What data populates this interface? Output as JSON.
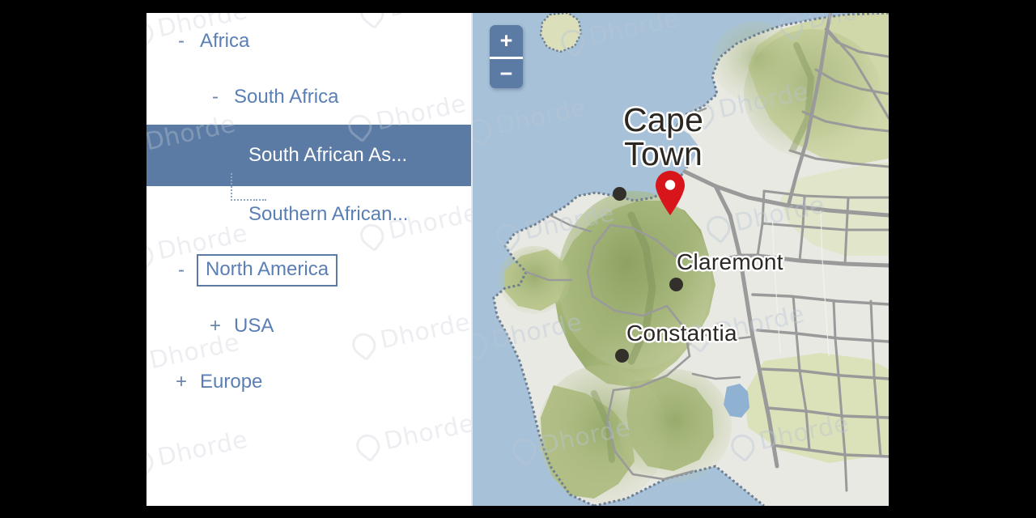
{
  "app": {
    "watermark_text": "Dhorde",
    "watermark_icon": "droplet-leaf-logo"
  },
  "sidebar": {
    "name": "region-tree",
    "items": [
      {
        "label": "Africa",
        "toggle": "-",
        "depth": 0,
        "state": "expanded"
      },
      {
        "label": "South Africa",
        "toggle": "-",
        "depth": 1,
        "state": "expanded"
      },
      {
        "label": "South African As...",
        "toggle": "",
        "depth": 2,
        "state": "selected"
      },
      {
        "label": "Southern African...",
        "toggle": "",
        "depth": 2,
        "state": "leaf"
      },
      {
        "label": "North America",
        "toggle": "-",
        "depth": 0,
        "state": "focused"
      },
      {
        "label": "USA",
        "toggle": "+",
        "depth": 1,
        "state": "collapsed"
      },
      {
        "label": "Europe",
        "toggle": "+",
        "depth": 0,
        "state": "collapsed"
      }
    ],
    "colors": {
      "text": "#5a7fb5",
      "selected_background": "#5b7ba5",
      "selected_text": "#ffffff",
      "focus_border": "#5b7ba5"
    }
  },
  "map": {
    "name": "terrain-map",
    "zoom_control": {
      "zoom_in_label": "+",
      "zoom_out_label": "−"
    },
    "marker": {
      "name": "location-pin",
      "color": "#d7151a",
      "at_place": "Cape Town"
    },
    "labels": [
      {
        "id": "cape-town",
        "text": "Cape\nTown"
      },
      {
        "id": "claremont",
        "text": "Claremont"
      },
      {
        "id": "constantia",
        "text": "Constantia"
      }
    ],
    "colors": {
      "water": "#a7c1d9",
      "land_urban": "#e9e9e4",
      "vegetation": "#b9c48c",
      "forest": "#93a96e",
      "road": "#8d8d8d",
      "label_text": "#2b2722"
    }
  }
}
